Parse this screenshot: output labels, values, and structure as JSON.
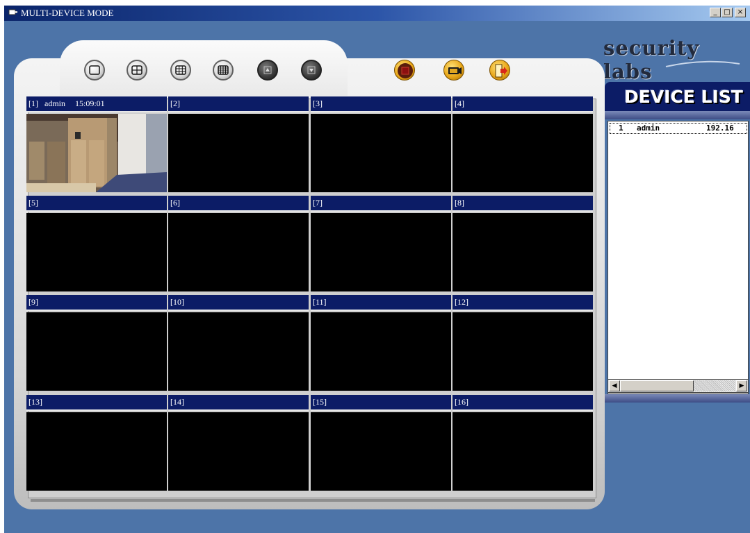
{
  "window": {
    "title": "MULTI-DEVICE MODE",
    "buttons": {
      "minimize": "_",
      "maximize": "□",
      "close": "×"
    }
  },
  "brand": "security labs",
  "toolbar": {
    "buttons": [
      {
        "name": "single-view-button",
        "icon": "single-screen-icon"
      },
      {
        "name": "quad-view-button",
        "icon": "quad-grid-icon"
      },
      {
        "name": "nine-view-button",
        "icon": "nine-grid-icon"
      },
      {
        "name": "sixteen-view-button",
        "icon": "sixteen-grid-icon"
      },
      {
        "name": "page-up-button",
        "icon": "arrow-up-icon"
      },
      {
        "name": "page-down-button",
        "icon": "arrow-down-icon"
      },
      {
        "name": "record-button",
        "icon": "record-icon"
      },
      {
        "name": "camera-button",
        "icon": "camera-icon"
      },
      {
        "name": "exit-button",
        "icon": "exit-door-icon"
      }
    ]
  },
  "channels": [
    {
      "label": "[1]",
      "user": "admin",
      "time": "15:09:01",
      "has_video": true
    },
    {
      "label": "[2]"
    },
    {
      "label": "[3]"
    },
    {
      "label": "[4]"
    },
    {
      "label": "[5]"
    },
    {
      "label": "[6]"
    },
    {
      "label": "[7]"
    },
    {
      "label": "[8]"
    },
    {
      "label": "[9]"
    },
    {
      "label": "[10]"
    },
    {
      "label": "[11]"
    },
    {
      "label": "[12]"
    },
    {
      "label": "[13]"
    },
    {
      "label": "[14]"
    },
    {
      "label": "[15]"
    },
    {
      "label": "[16]"
    }
  ],
  "device_list": {
    "title": "DEVICE LIST",
    "items": [
      {
        "index": "1",
        "name": "admin",
        "address": "192.16"
      }
    ]
  },
  "colors": {
    "background": "#4d74a8",
    "channel_header": "#0c1c66",
    "video_idle": "#000000"
  }
}
